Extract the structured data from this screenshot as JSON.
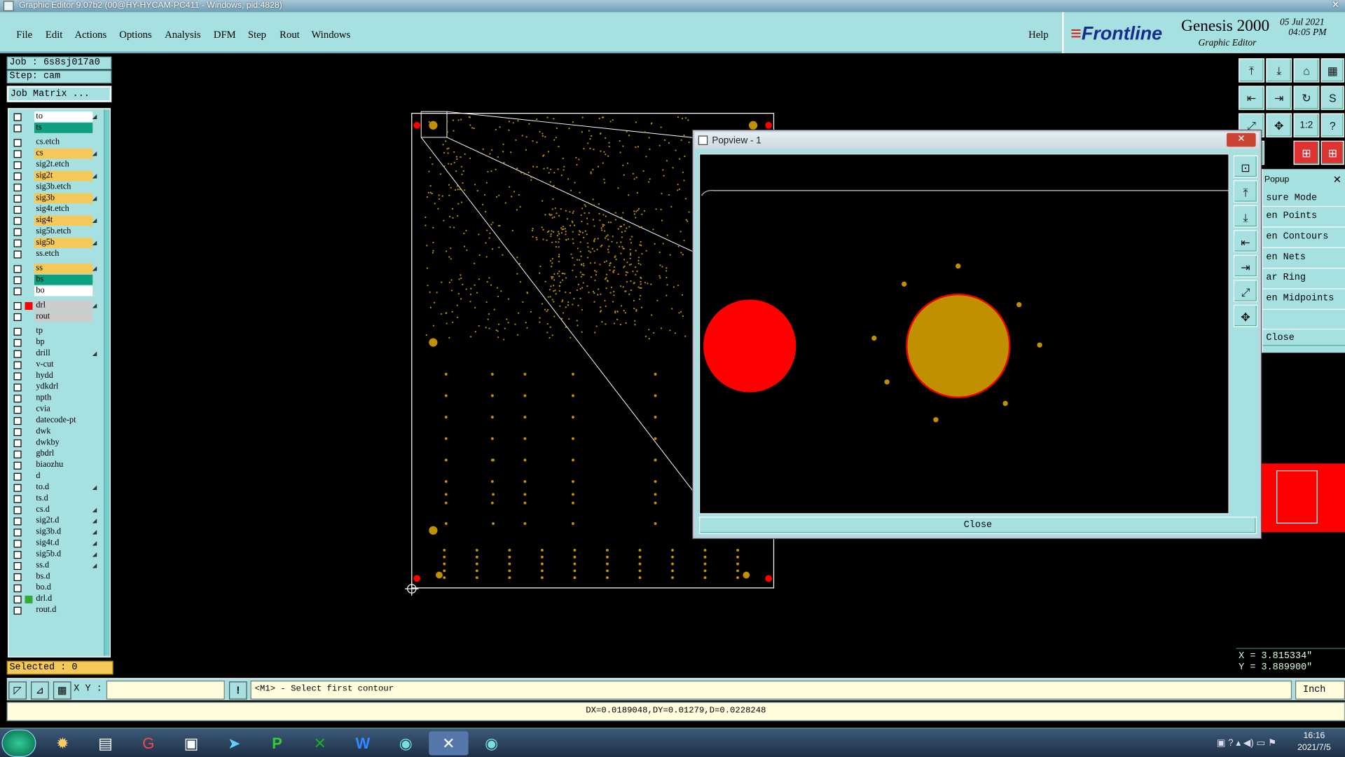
{
  "window": {
    "title": "Graphic Editor 9.07b2 (00@HY-HYCAM-PC411 - Windows, pid:4828)"
  },
  "menu": [
    "File",
    "Edit",
    "Actions",
    "Options",
    "Analysis",
    "DFM",
    "Step",
    "Rout",
    "Windows"
  ],
  "help_label": "Help",
  "brand": {
    "logo": "Frontline",
    "product": "Genesis 2000",
    "subtitle": "Graphic Editor",
    "date": "05 Jul 2021",
    "time": "04:05 PM"
  },
  "job": {
    "job": "Job : 6s8sj017a0",
    "step": "Step: cam",
    "matrix": "Job Matrix ..."
  },
  "layers": [
    {
      "name": "to",
      "color": "#ffffff",
      "arrow": true
    },
    {
      "name": "ts",
      "color": "#0fa080",
      "arrow": false
    },
    {
      "name": "cs.etch",
      "color": "#a6e0e0",
      "arrow": false
    },
    {
      "name": "cs",
      "color": "#f5c85a",
      "arrow": true
    },
    {
      "name": "sig2t.etch",
      "color": "#a6e0e0",
      "arrow": false
    },
    {
      "name": "sig2t",
      "color": "#f5c85a",
      "arrow": true
    },
    {
      "name": "sig3b.etch",
      "color": "#a6e0e0",
      "arrow": false
    },
    {
      "name": "sig3b",
      "color": "#f5c85a",
      "arrow": true
    },
    {
      "name": "sig4t.etch",
      "color": "#a6e0e0",
      "arrow": false
    },
    {
      "name": "sig4t",
      "color": "#f5c85a",
      "arrow": true
    },
    {
      "name": "sig5b.etch",
      "color": "#a6e0e0",
      "arrow": false
    },
    {
      "name": "sig5b",
      "color": "#f5c85a",
      "arrow": true
    },
    {
      "name": "ss.etch",
      "color": "#a6e0e0",
      "arrow": false
    },
    {
      "name": "ss",
      "color": "#f5c85a",
      "arrow": true
    },
    {
      "name": "bs",
      "color": "#0fa080",
      "arrow": false
    },
    {
      "name": "bo",
      "color": "#ffffff",
      "arrow": false
    },
    {
      "name": "drl",
      "color": "#cccccc",
      "arrow": true
    },
    {
      "name": "rout",
      "color": "#cccccc",
      "arrow": false
    },
    {
      "name": "tp",
      "color": "#a6e0e0",
      "arrow": false
    },
    {
      "name": "bp",
      "color": "#a6e0e0",
      "arrow": false
    },
    {
      "name": "drill",
      "color": "#a6e0e0",
      "arrow": true
    },
    {
      "name": "v-cut",
      "color": "#a6e0e0",
      "arrow": false
    },
    {
      "name": "hydd",
      "color": "#a6e0e0",
      "arrow": false
    },
    {
      "name": "ydkdrl",
      "color": "#a6e0e0",
      "arrow": false
    },
    {
      "name": "npth",
      "color": "#a6e0e0",
      "arrow": false
    },
    {
      "name": "cvia",
      "color": "#a6e0e0",
      "arrow": false
    },
    {
      "name": "datecode-pt",
      "color": "#a6e0e0",
      "arrow": false
    },
    {
      "name": "dwk",
      "color": "#a6e0e0",
      "arrow": false
    },
    {
      "name": "dwkby",
      "color": "#a6e0e0",
      "arrow": false
    },
    {
      "name": "gbdrl",
      "color": "#a6e0e0",
      "arrow": false
    },
    {
      "name": "biaozhu",
      "color": "#a6e0e0",
      "arrow": false
    },
    {
      "name": "d",
      "color": "#a6e0e0",
      "arrow": false
    },
    {
      "name": "to.d",
      "color": "#a6e0e0",
      "arrow": true
    },
    {
      "name": "ts.d",
      "color": "#a6e0e0",
      "arrow": false
    },
    {
      "name": "cs.d",
      "color": "#a6e0e0",
      "arrow": true
    },
    {
      "name": "sig2t.d",
      "color": "#a6e0e0",
      "arrow": true
    },
    {
      "name": "sig3b.d",
      "color": "#a6e0e0",
      "arrow": true
    },
    {
      "name": "sig4t.d",
      "color": "#a6e0e0",
      "arrow": true
    },
    {
      "name": "sig5b.d",
      "color": "#a6e0e0",
      "arrow": true
    },
    {
      "name": "ss.d",
      "color": "#a6e0e0",
      "arrow": true
    },
    {
      "name": "bs.d",
      "color": "#a6e0e0",
      "arrow": false
    },
    {
      "name": "bo.d",
      "color": "#a6e0e0",
      "arrow": false
    },
    {
      "name": "drl.d",
      "color": "#a6e0e0",
      "arrow": false
    },
    {
      "name": "rout.d",
      "color": "#a6e0e0",
      "arrow": false
    }
  ],
  "selected": "Selected : 0",
  "popview": {
    "title": "Popview - 1",
    "close": "Close"
  },
  "measure_popup": {
    "title": "Popup",
    "items": [
      "sure Mode",
      "en Points",
      "en Contours",
      "en Nets",
      "ar Ring",
      "en Midpoints"
    ],
    "close": "Close"
  },
  "coords": {
    "x": "X = 3.815334\"",
    "y": "Y = 3.889900\""
  },
  "cmd": {
    "xy_label": "X Y :",
    "message": "<M1> - Select first contour",
    "units": "Inch"
  },
  "status": "DX=0.0189048,DY=0.01279,D=0.0228248",
  "taskbar": {
    "time": "16:16",
    "date": "2021/7/5"
  },
  "colors": {
    "panel": "#a6e0e0",
    "pad": "#c09000",
    "drill": "#ff0000"
  }
}
